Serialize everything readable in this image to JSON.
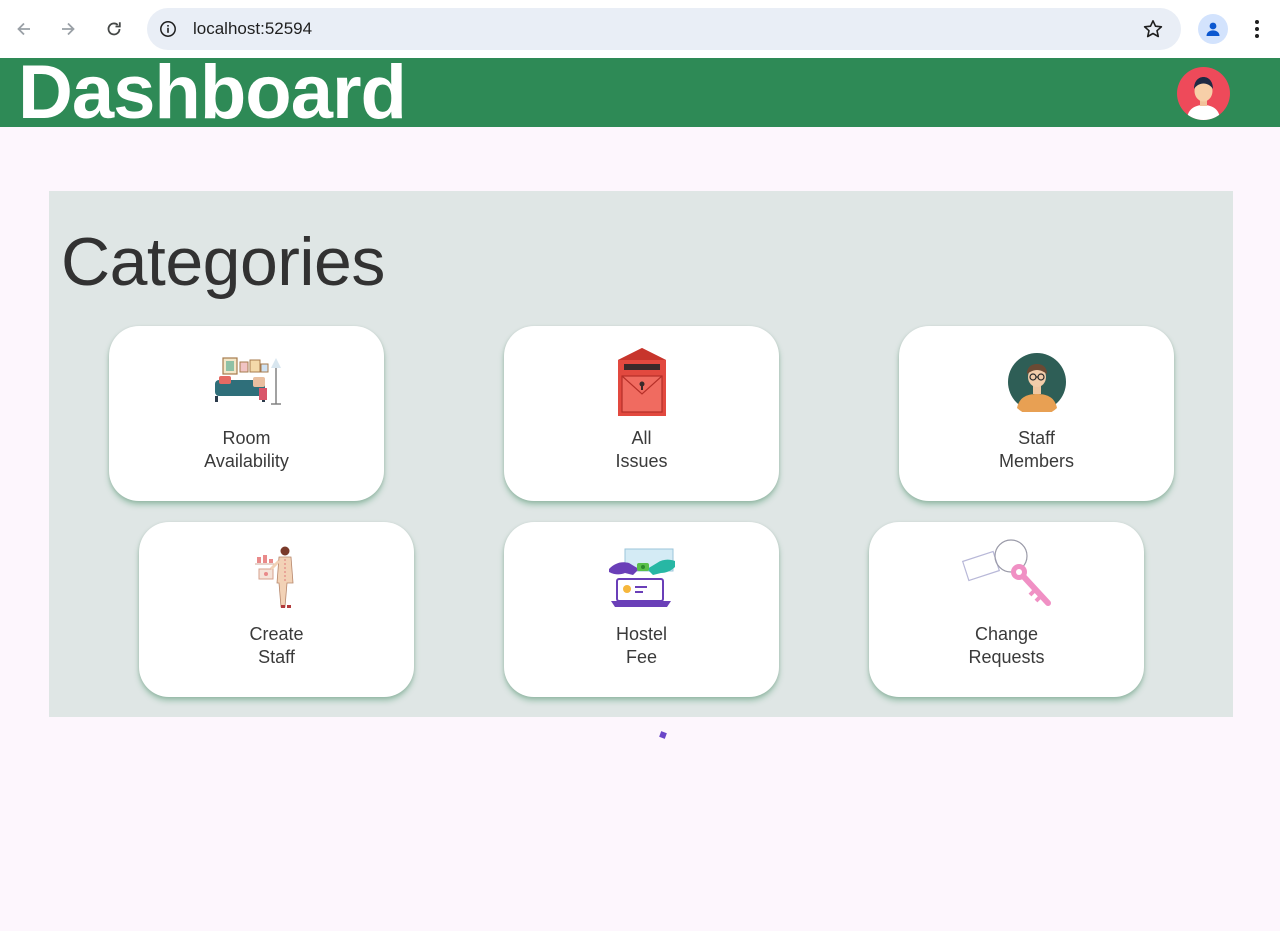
{
  "browser": {
    "url": "localhost:52594"
  },
  "header": {
    "title": "Dashboard"
  },
  "panel": {
    "title": "Categories",
    "cards": [
      {
        "line1": "Room",
        "line2": "Availability",
        "icon": "living-room-icon"
      },
      {
        "line1": "All",
        "line2": "Issues",
        "icon": "mailbox-icon"
      },
      {
        "line1": "Staff",
        "line2": "Members",
        "icon": "staff-person-icon"
      },
      {
        "line1": "Create",
        "line2": "Staff",
        "icon": "create-staff-icon"
      },
      {
        "line1": "Hostel",
        "line2": "Fee",
        "icon": "payment-icon"
      },
      {
        "line1": "Change",
        "line2": "Requests",
        "icon": "key-icon"
      }
    ]
  },
  "colors": {
    "header_bg": "#2e8a56",
    "page_bg": "#fdf6fd",
    "panel_bg": "#dfe6e5",
    "avatar_bg": "#ee4a5a"
  }
}
